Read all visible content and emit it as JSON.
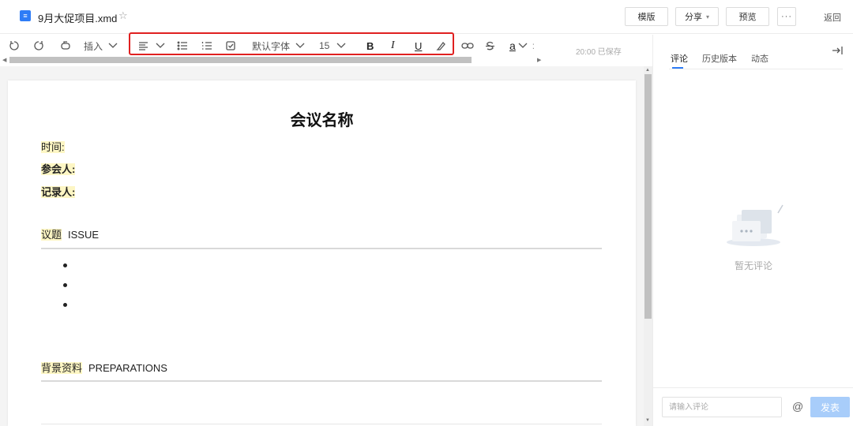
{
  "header": {
    "file_name": "9月大促项目.xmd",
    "file_icon_glyph": "≡",
    "star_glyph": "☆",
    "template_label": "模版",
    "share_label": "分享",
    "share_caret": "▾",
    "preview_label": "预览",
    "more_glyph": "···",
    "back_label": "返回"
  },
  "toolbar": {
    "insert_label": "插入",
    "font_label": "默认字体",
    "font_size": "15",
    "bold_label": "B",
    "italic_label": "I",
    "underline_label": "U",
    "text_color_label": "a",
    "overflow_glyph": ":",
    "save_status": "20:00 已保存",
    "icons": [
      "undo-icon",
      "redo-icon",
      "format-painter-icon",
      "align-icon",
      "bullet-list-icon",
      "numbered-list-icon",
      "checklist-icon",
      "eraser-icon",
      "link-icon",
      "strikethrough-icon"
    ]
  },
  "document": {
    "title": "会议名称",
    "time_label": "时间:",
    "attendees_label": "参会人:",
    "recorder_label": "记录人:",
    "issue_cn": "议题",
    "issue_en": "ISSUE",
    "prep_cn": "背景资料",
    "prep_en": "PREPARATIONS"
  },
  "panel": {
    "tabs": [
      "评论",
      "历史版本",
      "动态"
    ],
    "active_tab": "评论",
    "empty_text": "暂无评论",
    "comment_placeholder": "请输入评论",
    "at_glyph": "@",
    "send_label": "发表",
    "accent_color": "#2e7cf6",
    "send_color": "#a8cdfa"
  },
  "colors": {
    "highlight": "#fdf6c4",
    "red_outline": "#e02020"
  }
}
